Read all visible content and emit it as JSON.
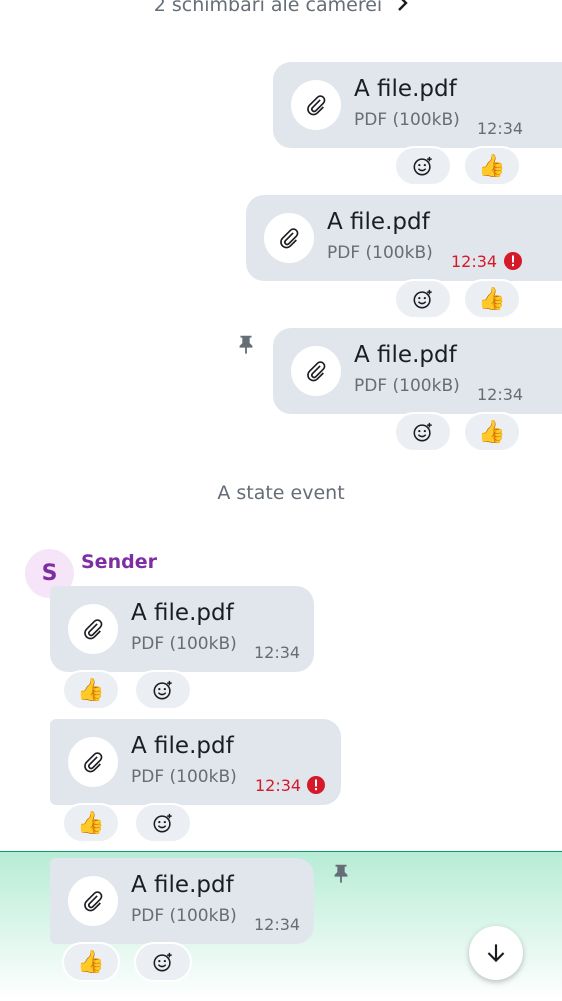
{
  "room_changes": {
    "text": "2 schimbări ale camerei"
  },
  "state_event": {
    "text": "A state event"
  },
  "sender": {
    "name": "Sender",
    "avatar_letter": "S"
  },
  "colors": {
    "bubble": "#e1e6ec",
    "error": "#d51928",
    "sender": "#7d2ea3",
    "highlight": "#b7ecd6"
  },
  "messages": [
    {
      "file_name": "A file.pdf",
      "file_meta": "PDF (100kB)",
      "time": "12:34",
      "failed": false,
      "reactions": [
        "add-reaction",
        "👍"
      ]
    },
    {
      "file_name": "A file.pdf",
      "file_meta": "PDF (100kB)",
      "time": "12:34",
      "failed": true,
      "reactions": [
        "add-reaction",
        "👍"
      ]
    },
    {
      "file_name": "A file.pdf",
      "file_meta": "PDF (100kB)",
      "time": "12:34",
      "failed": false,
      "pinned": true,
      "reactions": [
        "add-reaction",
        "👍"
      ]
    },
    {
      "file_name": "A file.pdf",
      "file_meta": "PDF (100kB)",
      "time": "12:34",
      "failed": false,
      "reactions": [
        "👍",
        "add-reaction"
      ]
    },
    {
      "file_name": "A file.pdf",
      "file_meta": "PDF (100kB)",
      "time": "12:34",
      "failed": true,
      "reactions": [
        "👍",
        "add-reaction"
      ]
    },
    {
      "file_name": "A file.pdf",
      "file_meta": "PDF (100kB)",
      "time": "12:34",
      "failed": false,
      "pinned": true,
      "highlighted": true,
      "reactions": [
        "👍",
        "add-reaction"
      ]
    }
  ],
  "reaction_emoji": "👍",
  "scroll_to_bottom_icon": "arrow-down-icon"
}
